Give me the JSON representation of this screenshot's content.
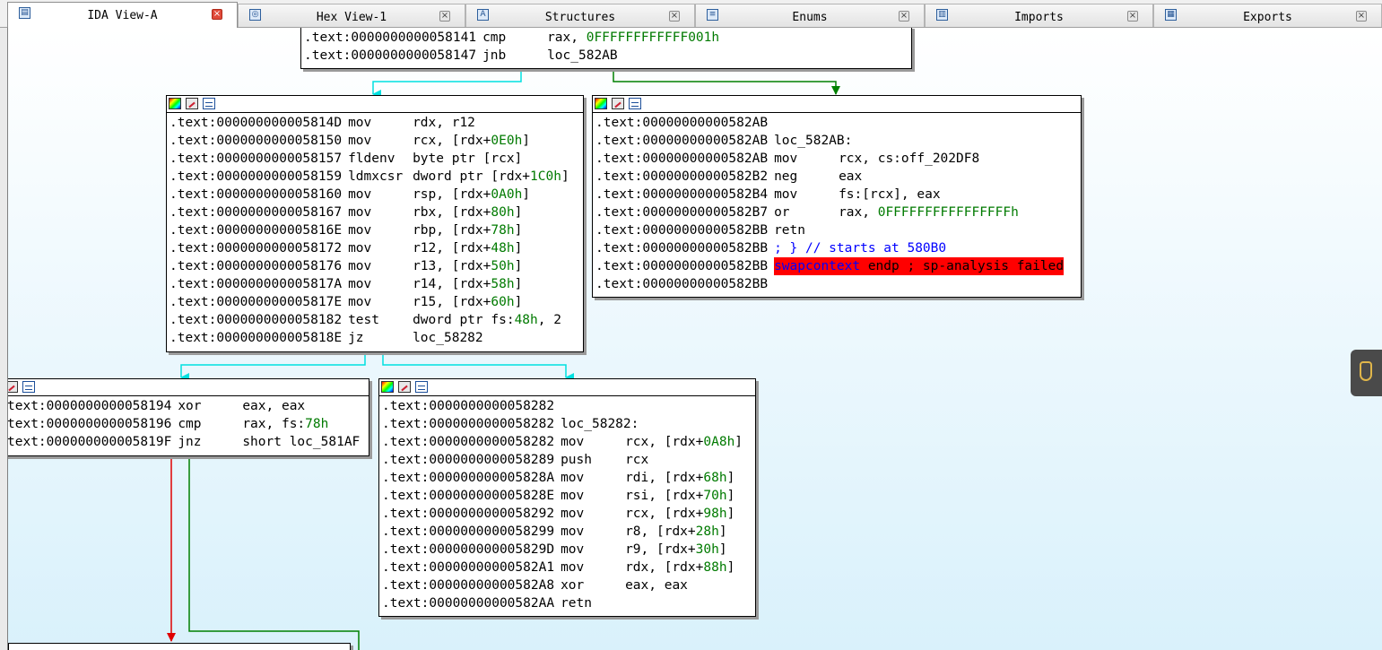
{
  "tabs": [
    {
      "label": "IDA View-A",
      "icon": "ida-view-icon",
      "active": true
    },
    {
      "label": "Hex View-1",
      "icon": "hex-view-icon",
      "active": false
    },
    {
      "label": "Structures",
      "icon": "structures-icon",
      "active": false
    },
    {
      "label": "Enums",
      "icon": "enums-icon",
      "active": false
    },
    {
      "label": "Imports",
      "icon": "imports-icon",
      "active": false
    },
    {
      "label": "Exports",
      "icon": "exports-icon",
      "active": false
    }
  ],
  "colors": {
    "true_branch": "#008000",
    "false_branch": "#e00000",
    "unconditional": "#00e0e0",
    "immediate": "#007a00",
    "error_highlight": "#ff0000",
    "function_name": "#0000ff"
  },
  "blocks": {
    "top": [
      {
        "addr": ".text:0000000000058141",
        "mn": "cmp",
        "op": "rax, ",
        "num": "0FFFFFFFFFFFF001h",
        "op2": ""
      },
      {
        "addr": ".text:0000000000058147",
        "mn": "jnb",
        "op": "loc_582AB",
        "num": "",
        "op2": ""
      }
    ],
    "left": [
      {
        "addr": ".text:000000000005814D",
        "mn": "mov",
        "op": "rdx, r12",
        "num": "",
        "op2": ""
      },
      {
        "addr": ".text:0000000000058150",
        "mn": "mov",
        "op": "rcx, [rdx+",
        "num": "0E0h",
        "op2": "]"
      },
      {
        "addr": ".text:0000000000058157",
        "mn": "fldenv",
        "op": "byte ptr [rcx]",
        "num": "",
        "op2": ""
      },
      {
        "addr": ".text:0000000000058159",
        "mn": "ldmxcsr",
        "op": "dword ptr [rdx+",
        "num": "1C0h",
        "op2": "]"
      },
      {
        "addr": ".text:0000000000058160",
        "mn": "mov",
        "op": "rsp, [rdx+",
        "num": "0A0h",
        "op2": "]"
      },
      {
        "addr": ".text:0000000000058167",
        "mn": "mov",
        "op": "rbx, [rdx+",
        "num": "80h",
        "op2": "]"
      },
      {
        "addr": ".text:000000000005816E",
        "mn": "mov",
        "op": "rbp, [rdx+",
        "num": "78h",
        "op2": "]"
      },
      {
        "addr": ".text:0000000000058172",
        "mn": "mov",
        "op": "r12, [rdx+",
        "num": "48h",
        "op2": "]"
      },
      {
        "addr": ".text:0000000000058176",
        "mn": "mov",
        "op": "r13, [rdx+",
        "num": "50h",
        "op2": "]"
      },
      {
        "addr": ".text:000000000005817A",
        "mn": "mov",
        "op": "r14, [rdx+",
        "num": "58h",
        "op2": "]"
      },
      {
        "addr": ".text:000000000005817E",
        "mn": "mov",
        "op": "r15, [rdx+",
        "num": "60h",
        "op2": "]"
      },
      {
        "addr": ".text:0000000000058182",
        "mn": "test",
        "op": "dword ptr fs:",
        "num": "48h",
        "op2": ", 2"
      },
      {
        "addr": ".text:000000000005818E",
        "mn": "jz",
        "op": "loc_58282",
        "num": "",
        "op2": ""
      }
    ],
    "right": {
      "addr_blank": ".text:00000000000582AB",
      "label_addr": ".text:00000000000582AB",
      "label": "loc_582AB:",
      "instrs": [
        {
          "addr": ".text:00000000000582AB",
          "mn": "mov",
          "op": "rcx, cs:off_202DF8",
          "num": "",
          "op2": ""
        },
        {
          "addr": ".text:00000000000582B2",
          "mn": "neg",
          "op": "eax",
          "num": "",
          "op2": ""
        },
        {
          "addr": ".text:00000000000582B4",
          "mn": "mov",
          "op": "fs:[rcx], eax",
          "num": "",
          "op2": ""
        },
        {
          "addr": ".text:00000000000582B7",
          "mn": "or",
          "op": "rax, ",
          "num": "0FFFFFFFFFFFFFFFFh",
          "op2": ""
        },
        {
          "addr": ".text:00000000000582BB",
          "mn": "retn",
          "op": "",
          "num": "",
          "op2": ""
        }
      ],
      "comment_addr": ".text:00000000000582BB",
      "comment": "; } // starts at 580B0",
      "err_addr": ".text:00000000000582BB",
      "err_func": "swapcontext",
      "err_rest": " endp ; sp-analysis failed",
      "end_addr": ".text:00000000000582BB"
    },
    "bottom_left": [
      {
        "addr": "text:0000000000058194",
        "mn": "xor",
        "op": "eax, eax",
        "num": "",
        "op2": ""
      },
      {
        "addr": "text:0000000000058196",
        "mn": "cmp",
        "op": "rax, fs:",
        "num": "78h",
        "op2": ""
      },
      {
        "addr": "text:000000000005819F",
        "mn": "jnz",
        "op": "short loc_581AF",
        "num": "",
        "op2": ""
      }
    ],
    "bottom_right": {
      "addr_blank": ".text:0000000000058282",
      "label_addr": ".text:0000000000058282",
      "label": "loc_58282:",
      "instrs": [
        {
          "addr": ".text:0000000000058282",
          "mn": "mov",
          "op": "rcx, [rdx+",
          "num": "0A8h",
          "op2": "]"
        },
        {
          "addr": ".text:0000000000058289",
          "mn": "push",
          "op": "rcx",
          "num": "",
          "op2": ""
        },
        {
          "addr": ".text:000000000005828A",
          "mn": "mov",
          "op": "rdi, [rdx+",
          "num": "68h",
          "op2": "]"
        },
        {
          "addr": ".text:000000000005828E",
          "mn": "mov",
          "op": "rsi, [rdx+",
          "num": "70h",
          "op2": "]"
        },
        {
          "addr": ".text:0000000000058292",
          "mn": "mov",
          "op": "rcx, [rdx+",
          "num": "98h",
          "op2": "]"
        },
        {
          "addr": ".text:0000000000058299",
          "mn": "mov",
          "op": "r8, [rdx+",
          "num": "28h",
          "op2": "]"
        },
        {
          "addr": ".text:000000000005829D",
          "mn": "mov",
          "op": "r9, [rdx+",
          "num": "30h",
          "op2": "]"
        },
        {
          "addr": ".text:00000000000582A1",
          "mn": "mov",
          "op": "rdx, [rdx+",
          "num": "88h",
          "op2": "]"
        },
        {
          "addr": ".text:00000000000582A8",
          "mn": "xor",
          "op": "eax, eax",
          "num": "",
          "op2": ""
        },
        {
          "addr": ".text:00000000000582AA",
          "mn": "retn",
          "op": "",
          "num": "",
          "op2": ""
        }
      ]
    }
  },
  "side_widget": {
    "icon": "usb-drive-icon"
  }
}
